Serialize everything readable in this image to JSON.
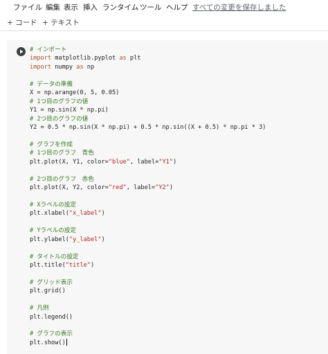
{
  "menu": {
    "items": [
      "ファイル",
      "編集",
      "表示",
      "挿入",
      "ランタイム",
      "ツール",
      "ヘルプ"
    ],
    "save_status": "すべての変更を保存しました"
  },
  "toolbar": {
    "add_code": "+ コード",
    "add_text": "+ テキスト"
  },
  "cell": {
    "lines": [
      [
        {
          "t": "# インポート",
          "c": "cm"
        }
      ],
      [
        {
          "t": "import",
          "c": "kw"
        },
        {
          "t": " matplotlib.pyplot ",
          "c": ""
        },
        {
          "t": "as",
          "c": "kw"
        },
        {
          "t": " plt",
          "c": ""
        }
      ],
      [
        {
          "t": "import",
          "c": "kw"
        },
        {
          "t": " numpy ",
          "c": ""
        },
        {
          "t": "as",
          "c": "kw"
        },
        {
          "t": " np",
          "c": ""
        }
      ],
      [],
      [
        {
          "t": "# データの準備",
          "c": "cm"
        }
      ],
      [
        {
          "t": "X = np.arange(0, 5, 0.05)",
          "c": ""
        }
      ],
      [
        {
          "t": "# 1つ目のグラフの値",
          "c": "cm"
        }
      ],
      [
        {
          "t": "Y1 = np.sin(X * np.pi)",
          "c": ""
        }
      ],
      [
        {
          "t": "# 2つ目のグラフの値",
          "c": "cm"
        }
      ],
      [
        {
          "t": "Y2 = 0.5 * np.sin(X * np.pi) + 0.5 * np.sin((X + 0.5) * np.pi * 3)",
          "c": ""
        }
      ],
      [],
      [
        {
          "t": "# グラフを作成",
          "c": "cm"
        }
      ],
      [
        {
          "t": "# 1つ目のグラフ　青色",
          "c": "cm"
        }
      ],
      [
        {
          "t": "plt.plot(X, Y1, color=",
          "c": ""
        },
        {
          "t": "\"blue\"",
          "c": "str"
        },
        {
          "t": ", label=",
          "c": ""
        },
        {
          "t": "\"Y1\"",
          "c": "str"
        },
        {
          "t": ")",
          "c": ""
        }
      ],
      [],
      [
        {
          "t": "# 2つ目のグラフ　赤色",
          "c": "cm"
        }
      ],
      [
        {
          "t": "plt.plot(X, Y2, color=",
          "c": ""
        },
        {
          "t": "\"red\"",
          "c": "str"
        },
        {
          "t": ", label=",
          "c": ""
        },
        {
          "t": "\"Y2\"",
          "c": "str"
        },
        {
          "t": ")",
          "c": ""
        }
      ],
      [],
      [
        {
          "t": "# Xラベルの設定",
          "c": "cm"
        }
      ],
      [
        {
          "t": "plt.xlabel(",
          "c": ""
        },
        {
          "t": "\"x_label\"",
          "c": "str"
        },
        {
          "t": ")",
          "c": ""
        }
      ],
      [],
      [
        {
          "t": "# Yラベルの設定",
          "c": "cm"
        }
      ],
      [
        {
          "t": "plt.ylabel(",
          "c": ""
        },
        {
          "t": "\"y_label\"",
          "c": "str"
        },
        {
          "t": ")",
          "c": ""
        }
      ],
      [],
      [
        {
          "t": "# タイトルの設定",
          "c": "cm"
        }
      ],
      [
        {
          "t": "plt.title(",
          "c": ""
        },
        {
          "t": "\"title\"",
          "c": "str"
        },
        {
          "t": ")",
          "c": ""
        }
      ],
      [],
      [
        {
          "t": "# グリッド表示",
          "c": "cm"
        }
      ],
      [
        {
          "t": "plt.grid()",
          "c": ""
        }
      ],
      [],
      [
        {
          "t": "# 凡例",
          "c": "cm"
        }
      ],
      [
        {
          "t": "plt.legend()",
          "c": ""
        }
      ],
      [],
      [
        {
          "t": "# グラフの表示",
          "c": "cm"
        }
      ],
      [
        {
          "t": "plt.show()",
          "c": ""
        }
      ]
    ]
  },
  "colors": {
    "comment": "#3b7a24",
    "keyword": "#a0522d",
    "string": "#b22222",
    "cell_background": "#f7f7f7"
  },
  "icons": {
    "run": "play-circle-icon"
  }
}
